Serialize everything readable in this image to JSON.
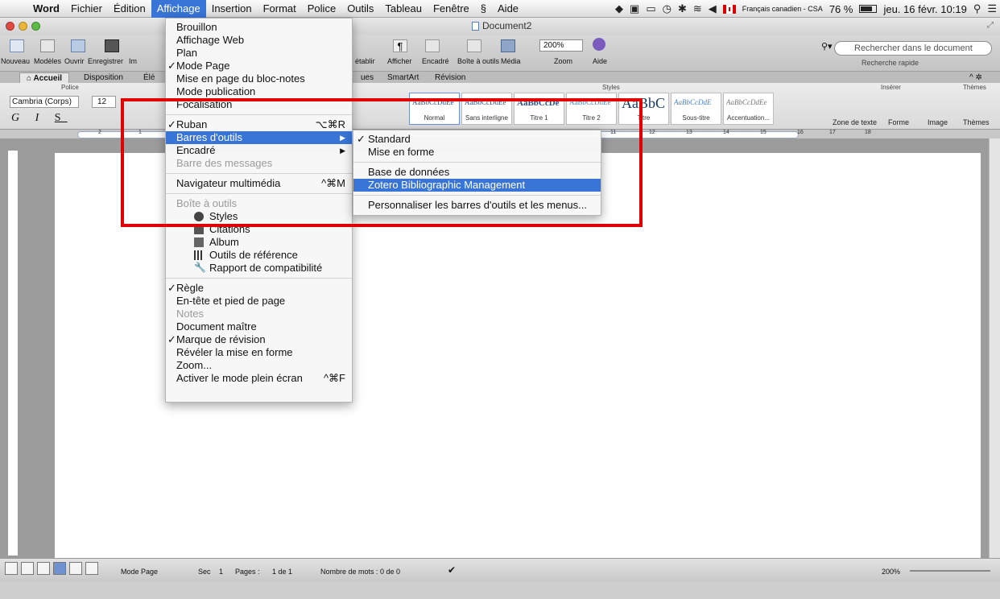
{
  "menubar": {
    "items": [
      "Word",
      "Fichier",
      "Édition",
      "Affichage",
      "Insertion",
      "Format",
      "Police",
      "Outils",
      "Tableau",
      "Fenêtre",
      "Aide"
    ],
    "input_source": "Français canadien - CSA",
    "battery": "76 %",
    "clock": "jeu. 16 févr. 10:19"
  },
  "window": {
    "title": "Document2"
  },
  "toolbar": {
    "labels": [
      "Nouveau",
      "Modèles",
      "Ouvrir",
      "Enregistrer",
      "Im",
      "établir",
      "Afficher",
      "Encadré",
      "Boîte à outils",
      "Média",
      "Zoom",
      "Aide"
    ],
    "zoom_value": "200%",
    "search_placeholder": "Rechercher dans le document",
    "quick_search": "Recherche rapide"
  },
  "ribbon": {
    "tabs": [
      "Accueil",
      "Disposition",
      "Élé",
      "ues",
      "SmartArt",
      "Révision"
    ],
    "groups": {
      "police": "Police",
      "styles": "Styles",
      "inserer": "Insérer",
      "themes": "Thèmes"
    },
    "font_name": "Cambria (Corps)",
    "font_size": "12",
    "style_samples": [
      {
        "sample": "AaBbCcDdEe",
        "name": "Normal"
      },
      {
        "sample": "AaBbCcDdEe",
        "name": "Sans interligne"
      },
      {
        "sample": "AaBbCcDe",
        "name": "Titre 1"
      },
      {
        "sample": "AaBbCcDdEe",
        "name": "Titre 2"
      },
      {
        "sample": "AaBbC",
        "name": "Titre"
      },
      {
        "sample": "AaBbCcDdE",
        "name": "Sous-titre"
      },
      {
        "sample": "AaBbCcDdEe",
        "name": "Accentuation..."
      }
    ],
    "insert_labels": [
      "Zone de texte",
      "Forme",
      "Image",
      "Thèmes"
    ]
  },
  "ruler": {
    "numbers": [
      "2",
      "1",
      "11",
      "12",
      "13",
      "14",
      "15",
      "16",
      "17",
      "18"
    ]
  },
  "affichage_menu": {
    "items": [
      {
        "label": "Brouillon"
      },
      {
        "label": "Affichage Web"
      },
      {
        "label": "Plan"
      },
      {
        "label": "Mode Page",
        "checked": "✓"
      },
      {
        "label": "Mise en page du bloc-notes"
      },
      {
        "label": "Mode publication"
      },
      {
        "label": "Focalisation"
      },
      {
        "label": "Ruban",
        "checked": "✓",
        "shortcut": "⌥⌘R"
      },
      {
        "label": "Barres d'outils"
      },
      {
        "label": "Encadré"
      },
      {
        "label": "Barre des messages"
      },
      {
        "label": "Navigateur multimédia",
        "shortcut": "^⌘M"
      },
      {
        "label": "Boîte à outils"
      },
      {
        "label": "Styles"
      },
      {
        "label": "Citations"
      },
      {
        "label": "Album"
      },
      {
        "label": "Outils de référence"
      },
      {
        "label": "Rapport de compatibilité"
      },
      {
        "label": "Règle",
        "checked": "✓"
      },
      {
        "label": "En-tête et pied de page"
      },
      {
        "label": "Notes"
      },
      {
        "label": "Document maître"
      },
      {
        "label": "Marque de révision",
        "checked": "✓"
      },
      {
        "label": "Révéler la mise en forme"
      },
      {
        "label": "Zoom..."
      },
      {
        "label": "Activer le mode plein écran",
        "shortcut": "^⌘F"
      }
    ]
  },
  "toolbars_submenu": {
    "items": [
      {
        "label": "Standard",
        "checked": "✓"
      },
      {
        "label": "Mise en forme"
      },
      {
        "label": "Base de données"
      },
      {
        "label": "Zotero Bibliographic Management"
      },
      {
        "label": "Personnaliser les barres d'outils et les menus..."
      }
    ]
  },
  "statusbar": {
    "view_mode": "Mode Page",
    "section": "Sec",
    "section_value": "1",
    "pages": "Pages :",
    "pages_value": "1 de 1",
    "words": "Nombre de mots :",
    "words_value": "0 de 0",
    "zoom": "200%"
  },
  "colors": {
    "highlight": "#3875d7",
    "annotation_box": "#e10000"
  }
}
